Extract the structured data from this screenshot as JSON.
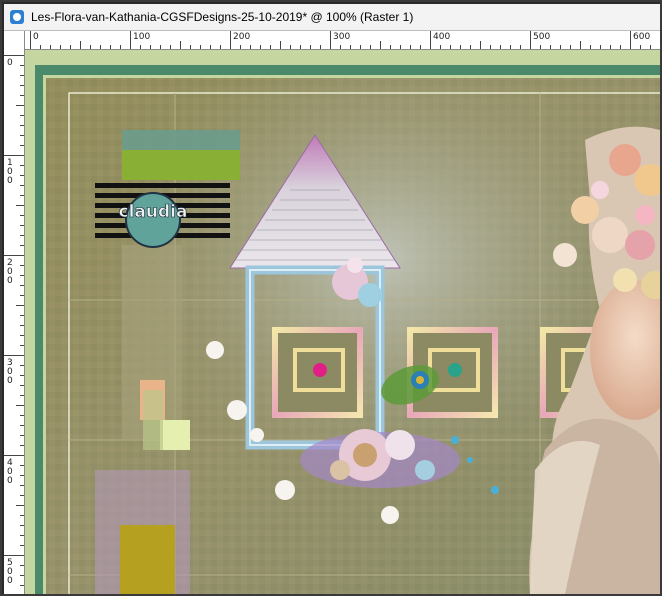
{
  "window": {
    "title": "Les-Flora-van-Kathania-CGSFDesigns-25-10-2019* @ 100% (Raster 1)"
  },
  "ruler_top": {
    "labels": [
      "0",
      "100",
      "200",
      "300",
      "400",
      "500",
      "600"
    ]
  },
  "ruler_left": {
    "labels": [
      "0",
      "100",
      "200",
      "300",
      "400",
      "500"
    ]
  },
  "artwork": {
    "watermark_text": "claudia",
    "colors": {
      "outer_frame": "#c5d6a0",
      "inner_frame": "#4a8a6b",
      "background": "#8e8c5c",
      "accent_pink": "#d94fa6"
    }
  }
}
